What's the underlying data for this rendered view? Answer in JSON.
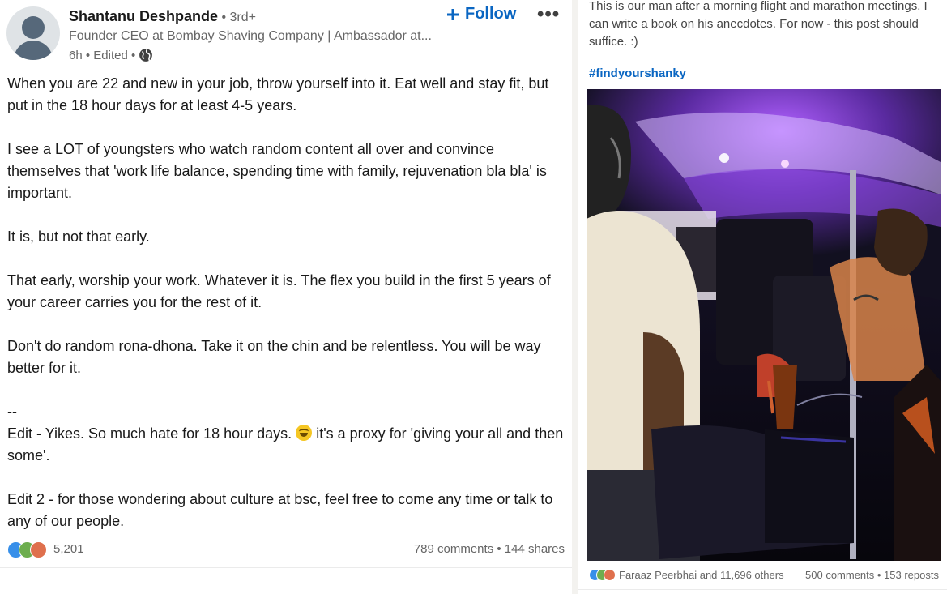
{
  "post": {
    "author": {
      "name": "Shantanu Deshpande",
      "degree": " • 3rd+",
      "headline": "Founder CEO at Bombay Shaving Company | Ambassador at...",
      "meta": "6h • Edited •"
    },
    "follow_label": "Follow",
    "more_label": "•••",
    "paragraphs": [
      "When you are 22 and new in your job, throw yourself into it. Eat well and stay fit, but put in the 18 hour days for at least 4-5 years.",
      "I see a LOT of youngsters who watch random content all over and convince themselves that 'work life balance, spending time with family, rejuvenation bla bla' is important.",
      "It is, but not that early.",
      "That early, worship your work. Whatever it is. The flex you build in the first 5 years of your career carries you for the rest of it.",
      "Don't do random rona-dhona. Take it on the chin and be relentless. You will be way better for it.",
      "--"
    ],
    "edit1_before": "Edit - Yikes. So much hate for 18 hour days. ",
    "edit1_after": " it's a proxy for 'giving your all and then some'.",
    "edit2": "Edit 2 - for those wondering about culture at bsc, feel free to come any time or talk to any of our people.",
    "reactions_count": "5,201",
    "comments_shares": "789 comments • 144 shares"
  },
  "side_post": {
    "text": "This is our man after a morning flight and marathon meetings. I can write a book on his anecdotes. For now - this post should suffice. :)",
    "hashtag": "#findyourshanky",
    "reactions_text": "Faraaz Peerbhai and 11,696 others",
    "comments_reposts": "500 comments • 153 reposts"
  },
  "colors": {
    "link_blue": "#0a66c2",
    "text_primary": "#191919",
    "text_secondary": "#666666",
    "like_blue": "#378fe9",
    "celebrate_green": "#6dae4f",
    "love_red": "#df704d"
  },
  "icons": [
    "person-avatar-icon",
    "plus-icon",
    "more-dots-icon",
    "globe-icon",
    "grinning-sweat-emoji",
    "like-reaction-icon",
    "celebrate-reaction-icon",
    "love-reaction-icon"
  ]
}
